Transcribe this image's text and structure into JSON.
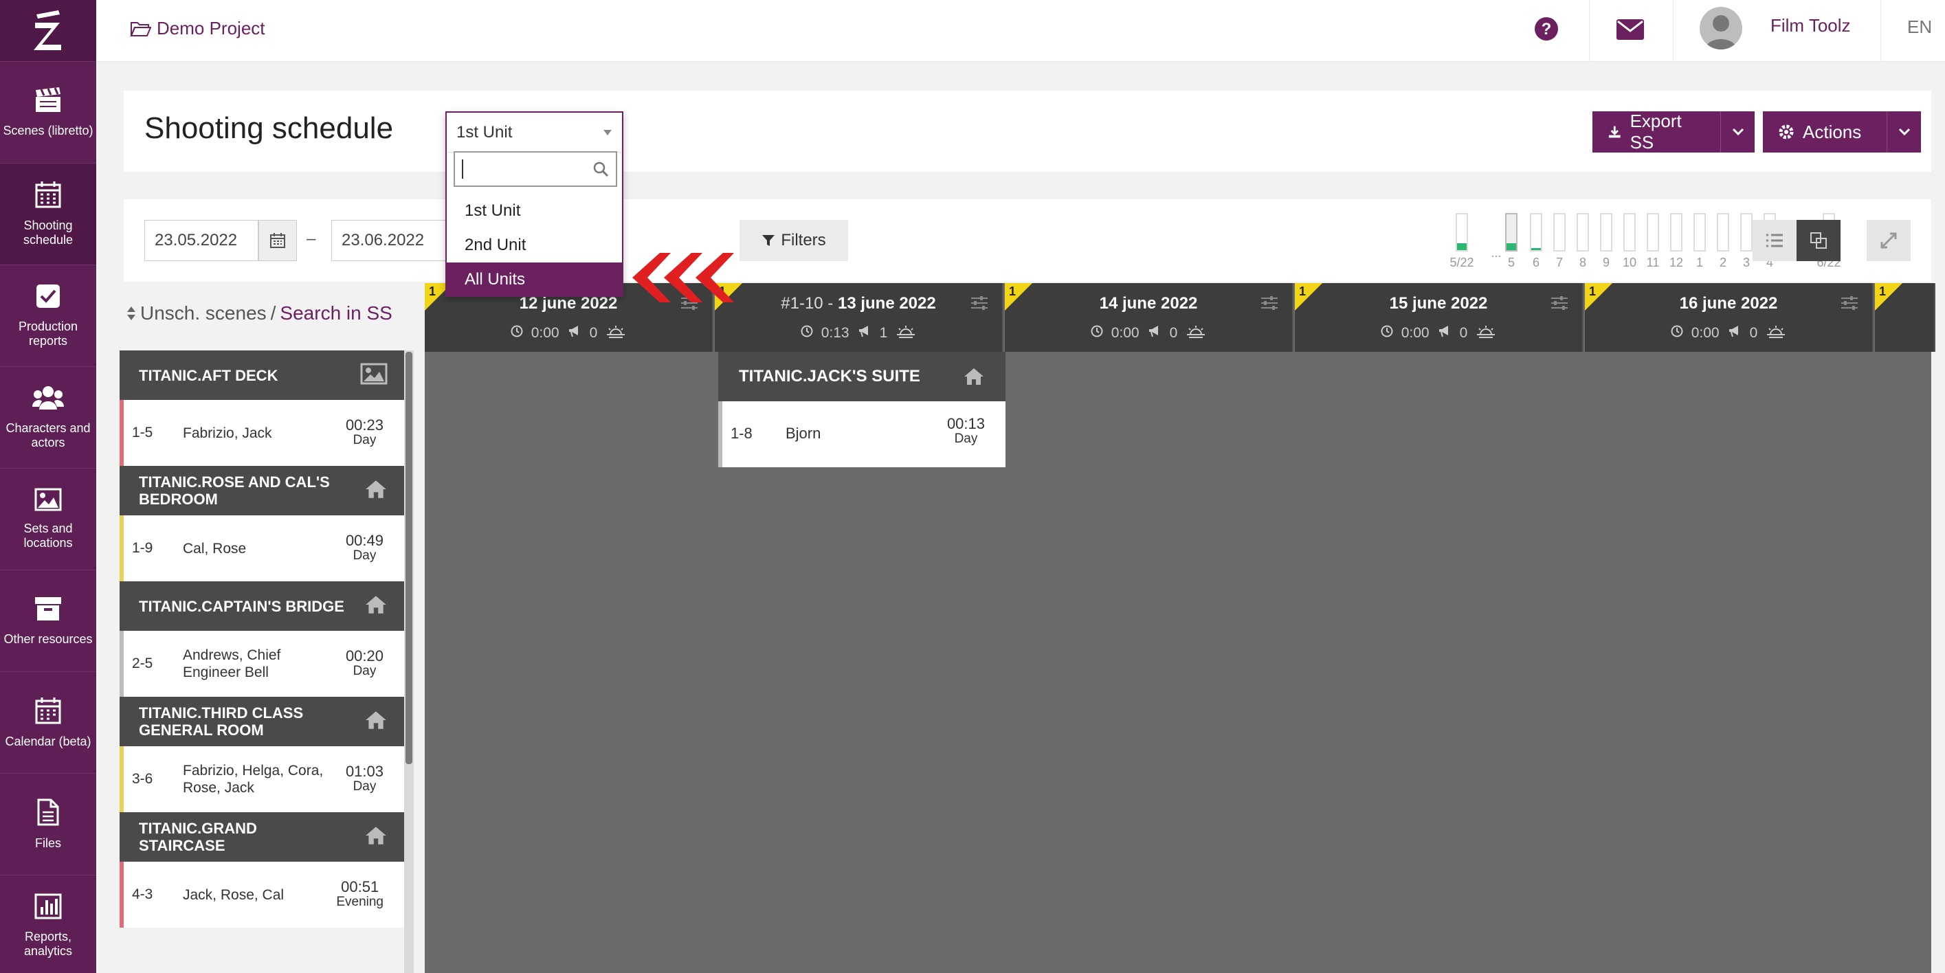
{
  "sidebar": {
    "logo": "Z",
    "items": [
      {
        "label": "Scenes (libretto)",
        "icon": "clapperboard-icon"
      },
      {
        "label": "Shooting schedule",
        "icon": "calendar-grid-icon"
      },
      {
        "label": "Production reports",
        "icon": "checkbox-icon"
      },
      {
        "label": "Characters and actors",
        "icon": "users-icon"
      },
      {
        "label": "Sets and locations",
        "icon": "image-icon"
      },
      {
        "label": "Other resources",
        "icon": "archive-box-icon"
      },
      {
        "label": "Calendar (beta)",
        "icon": "calendar-icon"
      },
      {
        "label": "Files",
        "icon": "file-icon"
      },
      {
        "label": "Reports, analytics",
        "icon": "bar-chart-icon"
      }
    ]
  },
  "topbar": {
    "project": "Demo Project",
    "user": "Film Toolz",
    "lang": "EN"
  },
  "header": {
    "title": "Shooting schedule",
    "unit_selected": "1st Unit",
    "export_label": "Export SS",
    "actions_label": "Actions"
  },
  "dropdown": {
    "options": [
      "1st Unit",
      "2nd Unit",
      "All Units"
    ],
    "active": "All Units"
  },
  "filters": {
    "date_from": "23.05.2022",
    "date_to": "23.06.2022",
    "dash": "–",
    "filters_label": "Filters"
  },
  "day_bars": [
    {
      "label": "5/22",
      "fill": 0.2
    },
    {
      "label": "...",
      "fill": 0
    },
    {
      "label": "5",
      "fill": 0.2
    },
    {
      "label": "6",
      "fill": 0.05
    },
    {
      "label": "7",
      "fill": 0
    },
    {
      "label": "8",
      "fill": 0
    },
    {
      "label": "9",
      "fill": 0
    },
    {
      "label": "10",
      "fill": 0
    },
    {
      "label": "11",
      "fill": 0
    },
    {
      "label": "12",
      "fill": 0
    },
    {
      "label": "1",
      "fill": 0
    },
    {
      "label": "2",
      "fill": 0
    },
    {
      "label": "3",
      "fill": 0
    },
    {
      "label": "4",
      "fill": 0
    },
    {
      "label": "...",
      "fill": 0
    },
    {
      "label": "6/22",
      "fill": 0.05
    }
  ],
  "unscheduled": {
    "title": "Unsch. scenes",
    "sep": "/",
    "search_link": "Search in SS",
    "groups": [
      {
        "name": "TITANIC.AFT DECK",
        "icon": "picture-icon",
        "scene": {
          "num": "1-5",
          "chars": "Fabrizio, Jack",
          "time": "00:23",
          "tod": "Day",
          "color": "#e06c75"
        }
      },
      {
        "name": "TITANIC.ROSE AND CAL'S BEDROOM",
        "icon": "home-icon",
        "scene": {
          "num": "1-9",
          "chars": "Cal, Rose",
          "time": "00:49",
          "tod": "Day",
          "color": "#e8d35a"
        }
      },
      {
        "name": "TITANIC.CAPTAIN'S BRIDGE",
        "icon": "home-icon",
        "scene": {
          "num": "2-5",
          "chars": "Andrews, Chief Engineer Bell",
          "time": "00:20",
          "tod": "Day",
          "color": "#bbbbbb"
        }
      },
      {
        "name": "TITANIC.THIRD CLASS GENERAL ROOM",
        "icon": "home-icon",
        "scene": {
          "num": "3-6",
          "chars": "Fabrizio, Helga, Cora, Rose, Jack",
          "time": "01:03",
          "tod": "Day",
          "color": "#e8d35a"
        }
      },
      {
        "name": "TITANIC.GRAND STAIRCASE",
        "icon": "home-icon",
        "scene": {
          "num": "4-3",
          "chars": "Jack, Rose, Cal",
          "time": "00:51",
          "tod": "Evening",
          "color": "#e06c75"
        }
      }
    ]
  },
  "days": [
    {
      "prefix": "",
      "title": "12 june 2022",
      "time": "0:00",
      "scenes": "0",
      "badge": "1"
    },
    {
      "prefix": "#1-10 - ",
      "title": "13 june 2022",
      "time": "0:13",
      "scenes": "1",
      "badge": "1"
    },
    {
      "prefix": "",
      "title": "14 june 2022",
      "time": "0:00",
      "scenes": "0",
      "badge": "1"
    },
    {
      "prefix": "",
      "title": "15 june 2022",
      "time": "0:00",
      "scenes": "0",
      "badge": "1"
    },
    {
      "prefix": "",
      "title": "16 june 2022",
      "time": "0:00",
      "scenes": "0",
      "badge": "1"
    },
    {
      "prefix": "",
      "title": "",
      "time": "",
      "scenes": "",
      "badge": "1"
    }
  ],
  "scheduled": {
    "set": "TITANIC.JACK'S SUITE",
    "scene": {
      "num": "1-8",
      "chars": "Bjorn",
      "time": "00:13",
      "tod": "Day"
    }
  },
  "colors": {
    "brand": "#6b2160",
    "accent_arrows": "#e02020",
    "badge": "#f2d516",
    "bar_fill": "#2bb673"
  }
}
